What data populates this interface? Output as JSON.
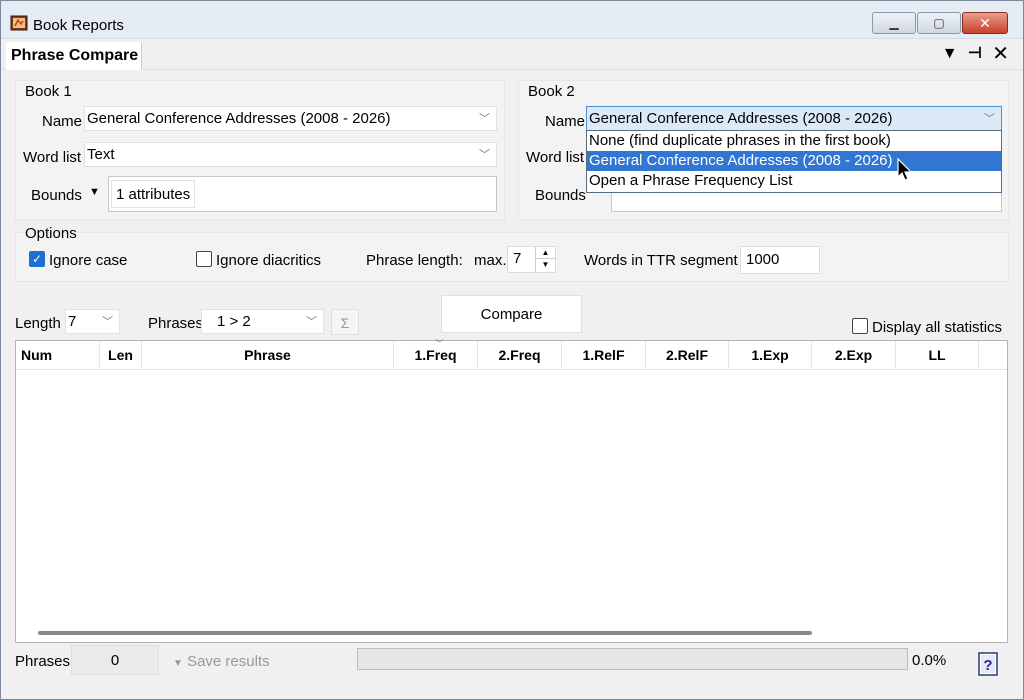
{
  "window": {
    "title": "Book Reports",
    "controls": {
      "minimize": "▁",
      "maximize": "▢",
      "close": "✕"
    }
  },
  "tab": {
    "label": "Phrase Compare",
    "tools": {
      "menu": "▼",
      "pin": "⊣",
      "close": "✕"
    }
  },
  "book1": {
    "group_label": "Book 1",
    "name_label": "Name",
    "name_value": "General Conference Addresses (2008 - 2026)",
    "wordlist_label": "Word list",
    "wordlist_value": "Text",
    "bounds_label": "Bounds",
    "bounds_chip": "1 attributes"
  },
  "book2": {
    "group_label": "Book 2",
    "name_label": "Name",
    "name_value": "General Conference Addresses (2008 - 2026)",
    "wordlist_label": "Word list",
    "bounds_label": "Bounds",
    "dropdown_options": [
      "None (find duplicate phrases in the first book)",
      "General Conference Addresses (2008 - 2026)",
      "Open a Phrase Frequency List"
    ]
  },
  "options": {
    "group_label": "Options",
    "ignore_case_label": "Ignore case",
    "ignore_case_checked": true,
    "ignore_diacritics_label": "Ignore diacritics",
    "ignore_diacritics_checked": false,
    "phrase_length_label": "Phrase length:",
    "max_label": "max.",
    "max_value": "7",
    "ttr_label": "Words in TTR segment",
    "ttr_value": "1000"
  },
  "controls": {
    "length_label": "Length",
    "length_value": "7",
    "phrases_label": "Phrases",
    "phrases_value": "1 > 2",
    "sigma": "Σ",
    "compare_label": "Compare",
    "display_all_label": "Display all statistics",
    "display_all_checked": false
  },
  "table": {
    "columns": [
      "Num",
      "Len",
      "Phrase",
      "1.Freq",
      "2.Freq",
      "1.RelF",
      "2.RelF",
      "1.Exp",
      "2.Exp",
      "LL"
    ],
    "rows": []
  },
  "status": {
    "phrases_label": "Phrases:",
    "phrases_count": "0",
    "save_results_label": "Save results",
    "progress_percent": "0.0%",
    "progress_value": 0
  }
}
